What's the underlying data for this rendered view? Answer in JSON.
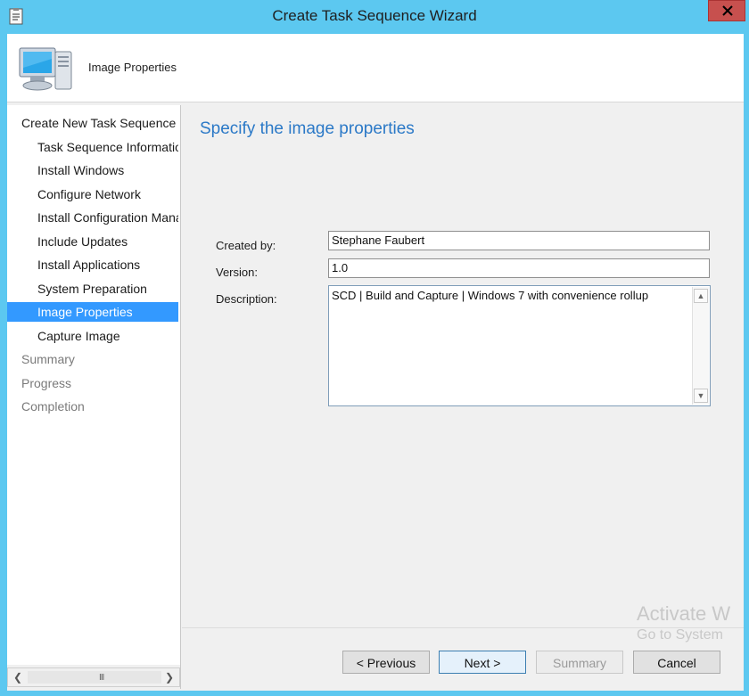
{
  "window": {
    "title": "Create Task Sequence Wizard"
  },
  "header": {
    "title": "Image Properties",
    "icon": "computer-icon"
  },
  "nav": {
    "items": [
      {
        "label": "Create New Task Sequence",
        "level": 0,
        "state": "normal"
      },
      {
        "label": "Task Sequence Information",
        "level": 1,
        "state": "normal"
      },
      {
        "label": "Install Windows",
        "level": 1,
        "state": "normal"
      },
      {
        "label": "Configure Network",
        "level": 1,
        "state": "normal"
      },
      {
        "label": "Install Configuration Manager",
        "level": 1,
        "state": "normal"
      },
      {
        "label": "Include Updates",
        "level": 1,
        "state": "normal"
      },
      {
        "label": "Install Applications",
        "level": 1,
        "state": "normal"
      },
      {
        "label": "System Preparation",
        "level": 1,
        "state": "normal"
      },
      {
        "label": "Image Properties",
        "level": 1,
        "state": "selected"
      },
      {
        "label": "Capture Image",
        "level": 1,
        "state": "normal"
      },
      {
        "label": "Summary",
        "level": 0,
        "state": "disabled"
      },
      {
        "label": "Progress",
        "level": 0,
        "state": "disabled"
      },
      {
        "label": "Completion",
        "level": 0,
        "state": "disabled"
      }
    ],
    "scroll_grip": "III"
  },
  "content": {
    "heading": "Specify the image properties",
    "created_by_label": "Created by:",
    "created_by_value": "Stephane Faubert",
    "version_label": "Version:",
    "version_value": "1.0",
    "description_label": "Description:",
    "description_value": "SCD | Build and Capture | Windows 7 with convenience rollup"
  },
  "buttons": {
    "previous": "< Previous",
    "next": "Next >",
    "summary": "Summary",
    "cancel": "Cancel"
  },
  "watermark": {
    "line1": "Activate W",
    "line2": "Go to System"
  },
  "colors": {
    "titlebar": "#5cc8f0",
    "accent": "#2b79c7",
    "selection": "#3399ff",
    "close": "#c7504e"
  }
}
